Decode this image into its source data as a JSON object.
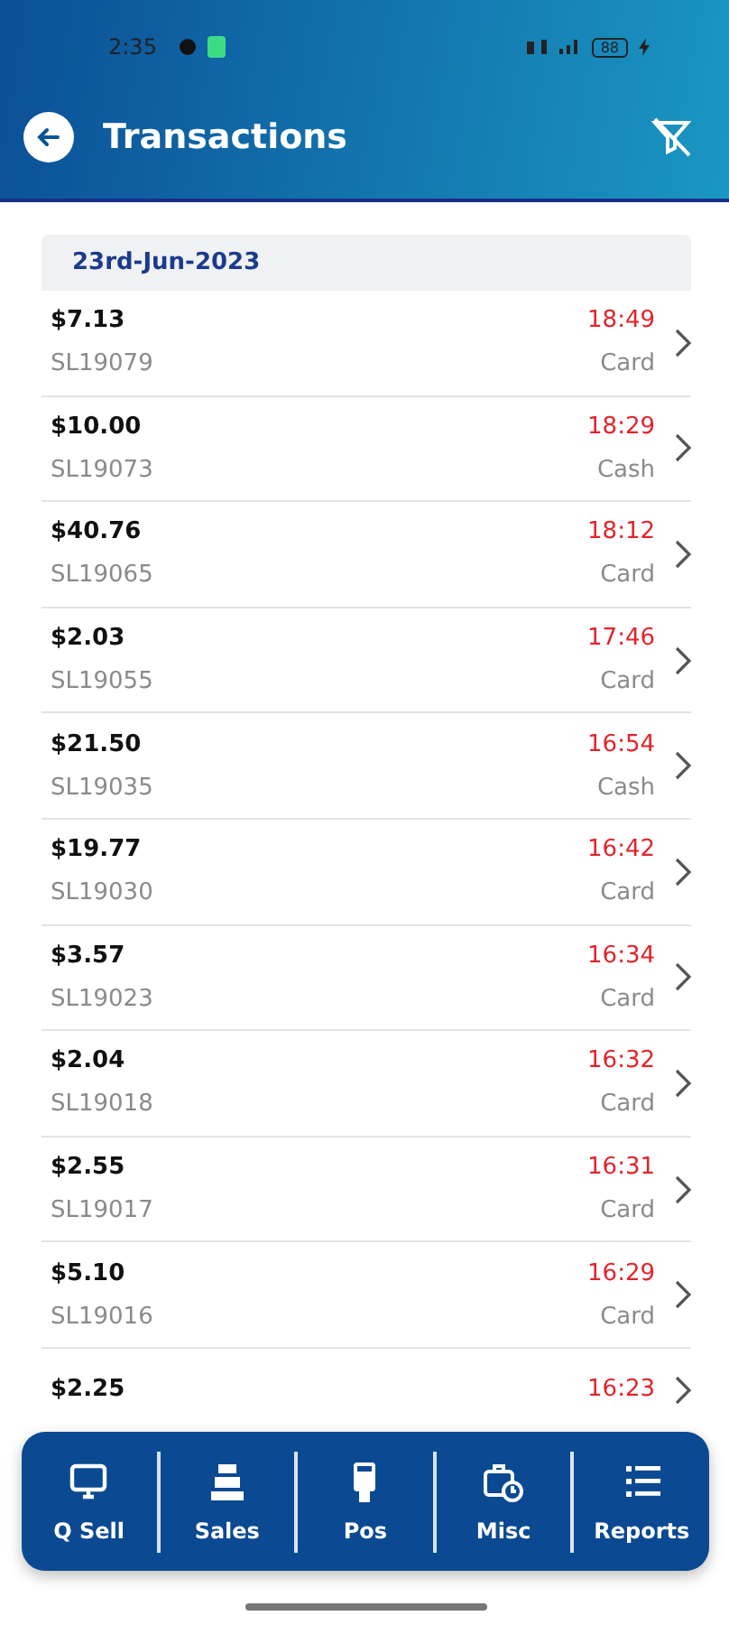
{
  "status_bar": {
    "time": "2:35",
    "battery": "88"
  },
  "header": {
    "title": "Transactions"
  },
  "date": "23rd-Jun-2023",
  "transactions": [
    {
      "amount": "$7.13",
      "ref": "SL19079",
      "time": "18:49",
      "method": "Card"
    },
    {
      "amount": "$10.00",
      "ref": "SL19073",
      "time": "18:29",
      "method": "Cash"
    },
    {
      "amount": "$40.76",
      "ref": "SL19065",
      "time": "18:12",
      "method": "Card"
    },
    {
      "amount": "$2.03",
      "ref": "SL19055",
      "time": "17:46",
      "method": "Card"
    },
    {
      "amount": "$21.50",
      "ref": "SL19035",
      "time": "16:54",
      "method": "Cash"
    },
    {
      "amount": "$19.77",
      "ref": "SL19030",
      "time": "16:42",
      "method": "Card"
    },
    {
      "amount": "$3.57",
      "ref": "SL19023",
      "time": "16:34",
      "method": "Card"
    },
    {
      "amount": "$2.04",
      "ref": "SL19018",
      "time": "16:32",
      "method": "Card"
    },
    {
      "amount": "$2.55",
      "ref": "SL19017",
      "time": "16:31",
      "method": "Card"
    },
    {
      "amount": "$5.10",
      "ref": "SL19016",
      "time": "16:29",
      "method": "Card"
    },
    {
      "amount": "$2.25",
      "time": "16:23"
    }
  ],
  "nav": [
    {
      "label": "Q Sell",
      "kind": "monitor"
    },
    {
      "label": "Sales",
      "kind": "register"
    },
    {
      "label": "Pos",
      "kind": "terminal"
    },
    {
      "label": "Misc",
      "kind": "bagclock"
    },
    {
      "label": "Reports",
      "kind": "list"
    }
  ]
}
